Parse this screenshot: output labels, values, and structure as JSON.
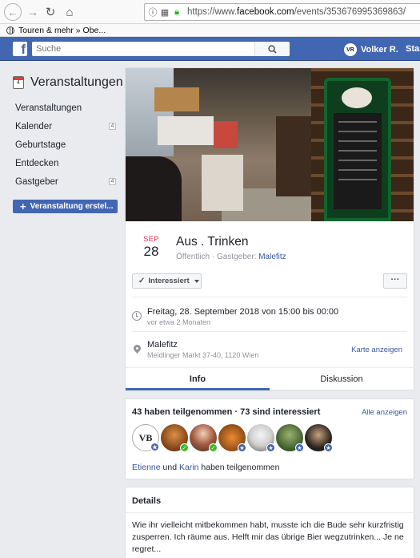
{
  "browser": {
    "url_prefix": "https://www.",
    "url_domain": "facebook.com",
    "url_path": "/events/353676995369863/",
    "bookmark": "Touren & mehr » Obe..."
  },
  "fb": {
    "logo": "f",
    "search_placeholder": "Suche",
    "user_name": "Volker R.",
    "user_avatar_text": "VR",
    "start_label": "Star"
  },
  "sidebar": {
    "calendar_day": "4",
    "title": "Veranstaltungen",
    "items": [
      {
        "label": "Veranstaltungen",
        "count": ""
      },
      {
        "label": "Kalender",
        "count": "4"
      },
      {
        "label": "Geburtstage",
        "count": ""
      },
      {
        "label": "Entdecken",
        "count": ""
      },
      {
        "label": "Gastgeber",
        "count": "4"
      }
    ],
    "create_label": "Veranstaltung erstel..."
  },
  "event": {
    "month": "SEP",
    "day": "28",
    "title": "Aus . Trinken",
    "visibility": "Öffentlich",
    "host_prefix": " · Gastgeber: ",
    "host": "Malefitz",
    "interested_label": "Interessiert",
    "more_label": "···",
    "time_main": "Freitag, 28. September 2018 von 15:00 bis 00:00",
    "time_sub": "vor etwa 2 Monaten",
    "place_main": "Malefitz",
    "place_sub": "Meidlinger Markt 37-40, 1120 Wien",
    "map_link": "Karte anzeigen",
    "tabs": [
      "Info",
      "Diskussion"
    ]
  },
  "participants": {
    "title": "43 haben teilgenommen · 73 sind interessiert",
    "link": "Alle anzeigen",
    "logo_text": "VB",
    "name1": "Etienne",
    "and": " und ",
    "name2": "Karin",
    "suffix": " haben teilgenommen"
  },
  "details": {
    "title": "Details",
    "text": "Wie ihr vielleicht mitbekommen habt, musste ich die Bude sehr kurzfristig zusperren. Ich räume aus. Helft mir das übrige Bier wegzutrinken... Je ne regret..."
  },
  "colors": {
    "fb_blue": "#4267b2",
    "link": "#365899",
    "month_red": "#f02849",
    "going_green": "#42b72a"
  }
}
